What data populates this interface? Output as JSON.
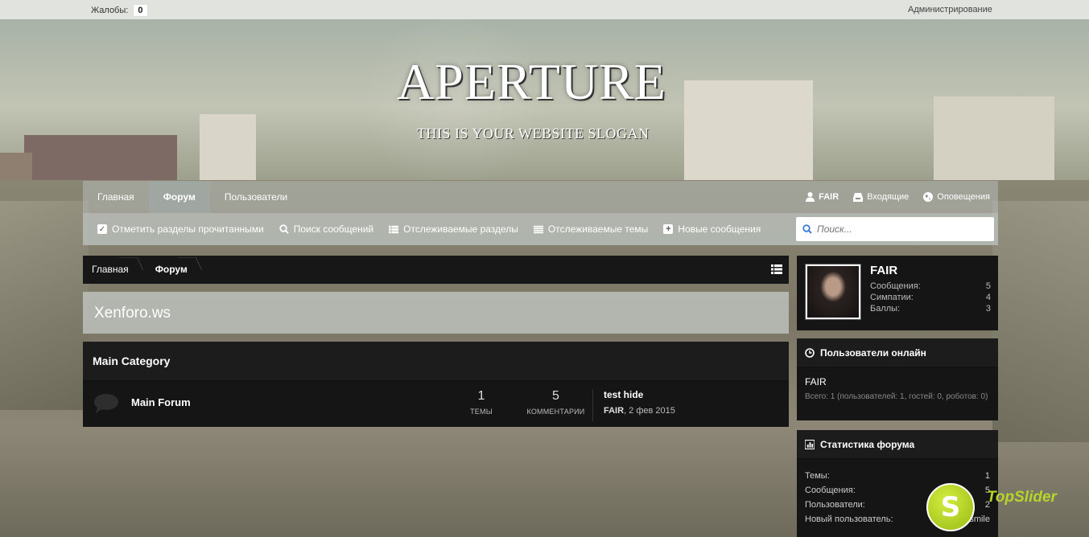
{
  "topbar": {
    "complaints_label": "Жалобы:",
    "complaints_count": "0",
    "admin_label": "Администрирование"
  },
  "header": {
    "logo_title": "APERTURE",
    "slogan": "THIS IS YOUR WEBSITE SLOGAN"
  },
  "nav": {
    "tabs": [
      {
        "label": "Главная"
      },
      {
        "label": "Форум"
      },
      {
        "label": "Пользователи"
      }
    ],
    "user": {
      "name": "FAIR",
      "inbox_label": "Входящие",
      "alerts_label": "Оповещения"
    },
    "subnav": {
      "mark_read": "Отметить разделы прочитанными",
      "search_posts": "Поиск сообщений",
      "watched_forums": "Отслеживаемые разделы",
      "watched_threads": "Отслеживаемые темы",
      "new_posts": "Новые сообщения"
    },
    "search_placeholder": "Поиск..."
  },
  "breadcrumb": {
    "items": [
      {
        "label": "Главная"
      },
      {
        "label": "Форум"
      }
    ]
  },
  "page": {
    "title": "Xenforo.ws"
  },
  "category": {
    "title": "Main Category",
    "forum": {
      "name": "Main Forum",
      "threads_count": "1",
      "threads_label": "Темы",
      "posts_count": "5",
      "posts_label": "Комментарии",
      "last_title": "test hide",
      "last_user": "FAIR",
      "last_date": ", 2 фев 2015"
    }
  },
  "sidebar": {
    "user": {
      "name": "FAIR",
      "stats": [
        {
          "label": "Сообщения:",
          "value": "5"
        },
        {
          "label": "Симпатии:",
          "value": "4"
        },
        {
          "label": "Баллы:",
          "value": "3"
        }
      ]
    },
    "online": {
      "title": "Пользователи онлайн",
      "users": "FAIR",
      "total": "Всего: 1 (пользователей: 1, гостей: 0, роботов: 0)"
    },
    "stats": {
      "title": "Статистика форума",
      "rows": [
        {
          "label": "Темы:",
          "value": "1"
        },
        {
          "label": "Сообщения:",
          "value": "5"
        },
        {
          "label": "Пользователи:",
          "value": "2"
        },
        {
          "label": "Новый пользователь:",
          "value": "smile"
        }
      ]
    }
  },
  "watermark": {
    "letter": "S",
    "text": "TopSlider"
  }
}
